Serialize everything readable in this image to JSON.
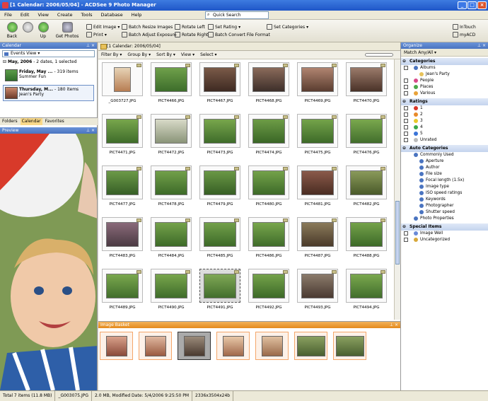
{
  "window": {
    "title": "[1 Calendar: 2006/05/04] - ACDSee 9 Photo Manager"
  },
  "menu": [
    "File",
    "Edit",
    "View",
    "Create",
    "Tools",
    "Database",
    "Help"
  ],
  "quick_search": {
    "label": "Quick Search"
  },
  "toolbar": {
    "back": "Back",
    "up": "Up",
    "get_photos": "Get Photos",
    "edit_image": "Edit Image",
    "print": "Print",
    "batch_resize": "Batch Resize Images",
    "batch_exposure": "Batch Adjust Exposure",
    "rotate_left": "Rotate Left",
    "rotate_right": "Rotate Right",
    "set_rating": "Set Rating",
    "batch_convert": "Batch Convert File Format",
    "set_categories": "Set Categories",
    "intouch": "InTouch",
    "myacd": "myACD"
  },
  "calendar": {
    "header": "Calendar",
    "view": "Events View",
    "month_label": "May, 2006",
    "month_info": "- 2 dates, 1 selected",
    "events": [
      {
        "date": "Friday, May ...",
        "count": "- 319 items",
        "name": "Summer Fun"
      },
      {
        "date": "Thursday, M...",
        "count": "- 180 items",
        "name": "Jean's Party"
      }
    ],
    "tabs": [
      "Folders",
      "Calendar",
      "Favorites"
    ]
  },
  "preview": {
    "header": "Preview"
  },
  "browser": {
    "path": "[1 Calendar: 2006/05/04]",
    "filter_by": "Filter By",
    "group_by": "Group By",
    "sort_by": "Sort By",
    "view": "View",
    "select": "Select",
    "thumbnails": [
      "_G003727.JPG",
      "PICT4466.JPG",
      "PICT4467.JPG",
      "PICT4468.JPG",
      "PICT4469.JPG",
      "PICT4470.JPG",
      "PICT4471.JPG",
      "PICT4472.JPG",
      "PICT4473.JPG",
      "PICT4474.JPG",
      "PICT4475.JPG",
      "PICT4476.JPG",
      "PICT4477.JPG",
      "PICT4478.JPG",
      "PICT4479.JPG",
      "PICT4480.JPG",
      "PICT4481.JPG",
      "PICT4482.JPG",
      "PICT4483.JPG",
      "PICT4484.JPG",
      "PICT4485.JPG",
      "PICT4486.JPG",
      "PICT4487.JPG",
      "PICT4488.JPG",
      "PICT4489.JPG",
      "PICT4490.JPG",
      "PICT4491.JPG",
      "PICT4492.JPG",
      "PICT4493.JPG",
      "PICT4494.JPG"
    ]
  },
  "basket": {
    "header": "Image Basket"
  },
  "organize": {
    "header": "Organize",
    "match": "Match Any/All",
    "categories_header": "Categories",
    "categories": [
      "Albums",
      "Jean's Party",
      "People",
      "Places",
      "Various"
    ],
    "ratings_header": "Ratings",
    "ratings": [
      "1",
      "2",
      "3",
      "4",
      "5",
      "Unrated"
    ],
    "auto_header": "Auto Categories",
    "auto": [
      "Commonly Used",
      "Aperture",
      "Author",
      "File size",
      "Focal length (1.5x)",
      "Image type",
      "ISO speed ratings",
      "Keywords",
      "Photographer",
      "Shutter speed",
      "Photo Properties"
    ],
    "special_header": "Special Items",
    "special": [
      "Image Well",
      "Uncategorized"
    ]
  },
  "status": {
    "total": "Total 7 items (11.8 MB)",
    "file": "_G003075.JPG",
    "info": "2.0 MB, Modified Date: 5/4/2006 9:25:50 PM",
    "dims": "2336x3504x24b"
  }
}
